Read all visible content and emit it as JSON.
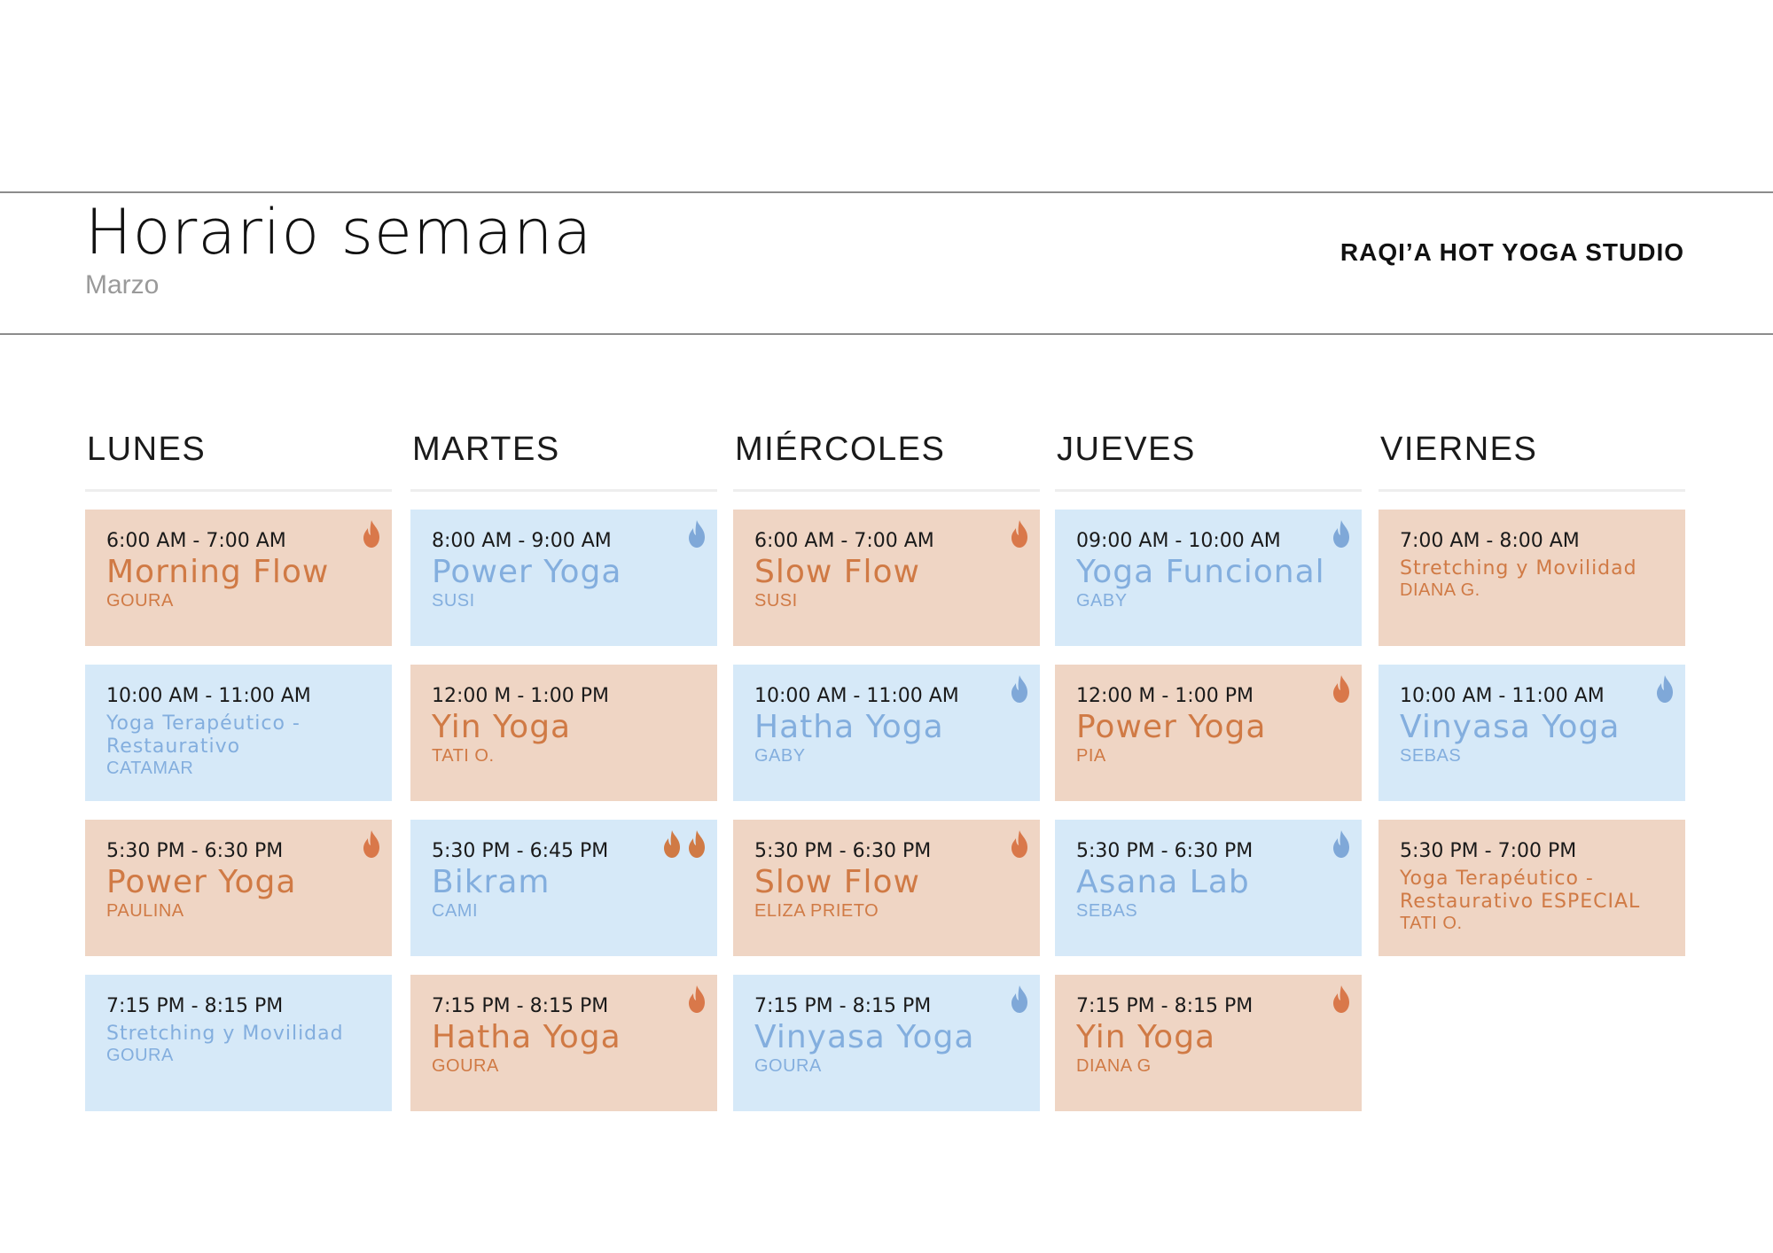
{
  "header": {
    "title": "Horario semana",
    "subtitle": "Marzo",
    "studio": "RAQI’A HOT YOGA STUDIO"
  },
  "colors": {
    "hot_bg": "#efd5c4",
    "hot_text": "#d07a45",
    "cool_bg": "#d6e9f8",
    "cool_text": "#83aede"
  },
  "days": [
    {
      "name": "LUNES",
      "classes": [
        {
          "time": "6:00 AM - 7:00 AM",
          "name": "Morning Flow",
          "teacher": "GOURA",
          "style": "hot",
          "flames": 1,
          "small": false
        },
        {
          "time": "10:00 AM - 11:00 AM",
          "name": "Yoga Terapéutico - Restaurativo",
          "teacher": "CATAMAR",
          "style": "cool",
          "flames": 0,
          "small": true
        },
        {
          "time": "5:30 PM - 6:30 PM",
          "name": "Power Yoga",
          "teacher": "PAULINA",
          "style": "hot",
          "flames": 1,
          "small": false
        },
        {
          "time": "7:15 PM - 8:15 PM",
          "name": "Stretching y Movilidad",
          "teacher": "GOURA",
          "style": "cool",
          "flames": 0,
          "small": true
        }
      ]
    },
    {
      "name": "MARTES",
      "classes": [
        {
          "time": "8:00 AM - 9:00 AM",
          "name": "Power Yoga",
          "teacher": "SUSI",
          "style": "cool",
          "flames": 1,
          "small": false
        },
        {
          "time": "12:00 M - 1:00 PM",
          "name": "Yin Yoga",
          "teacher": "TATI O.",
          "style": "hot",
          "flames": 0,
          "small": false
        },
        {
          "time": "5:30 PM - 6:45 PM",
          "name": "Bikram",
          "teacher": "CAMI",
          "style": "cool",
          "flames": 2,
          "flame_style": "hot",
          "small": false
        },
        {
          "time": "7:15 PM - 8:15 PM",
          "name": "Hatha Yoga",
          "teacher": "GOURA",
          "style": "hot",
          "flames": 1,
          "small": false
        }
      ]
    },
    {
      "name": "MIÉRCOLES",
      "classes": [
        {
          "time": "6:00 AM - 7:00 AM",
          "name": "Slow Flow",
          "teacher": "SUSI",
          "style": "hot",
          "flames": 1,
          "small": false
        },
        {
          "time": "10:00 AM - 11:00 AM",
          "name": "Hatha Yoga",
          "teacher": "GABY",
          "style": "cool",
          "flames": 1,
          "small": false
        },
        {
          "time": "5:30 PM - 6:30 PM",
          "name": "Slow Flow",
          "teacher": "ELIZA PRIETO",
          "style": "hot",
          "flames": 1,
          "small": false
        },
        {
          "time": "7:15 PM - 8:15 PM",
          "name": "Vinyasa Yoga",
          "teacher": "GOURA",
          "style": "cool",
          "flames": 1,
          "small": false
        }
      ]
    },
    {
      "name": "JUEVES",
      "classes": [
        {
          "time": "09:00 AM - 10:00 AM",
          "name": "Yoga Funcional",
          "teacher": "GABY",
          "style": "cool",
          "flames": 1,
          "small": false
        },
        {
          "time": "12:00 M - 1:00 PM",
          "name": "Power Yoga",
          "teacher": "PIA",
          "style": "hot",
          "flames": 1,
          "small": false
        },
        {
          "time": "5:30 PM - 6:30 PM",
          "name": "Asana Lab",
          "teacher": "SEBAS",
          "style": "cool",
          "flames": 1,
          "small": false
        },
        {
          "time": "7:15 PM - 8:15 PM",
          "name": "Yin Yoga",
          "teacher": "DIANA G",
          "style": "hot",
          "flames": 1,
          "small": false
        }
      ]
    },
    {
      "name": "VIERNES",
      "classes": [
        {
          "time": "7:00 AM - 8:00 AM",
          "name": "Stretching y Movilidad",
          "teacher": "DIANA G.",
          "style": "hot",
          "flames": 0,
          "small": true
        },
        {
          "time": "10:00 AM - 11:00 AM",
          "name": "Vinyasa Yoga",
          "teacher": "SEBAS",
          "style": "cool",
          "flames": 1,
          "small": false
        },
        {
          "time": "5:30 PM - 7:00 PM",
          "name": "Yoga Terapéutico - Restaurativo ESPECIAL",
          "teacher": "TATI O.",
          "style": "hot",
          "flames": 0,
          "small": true
        }
      ]
    }
  ]
}
